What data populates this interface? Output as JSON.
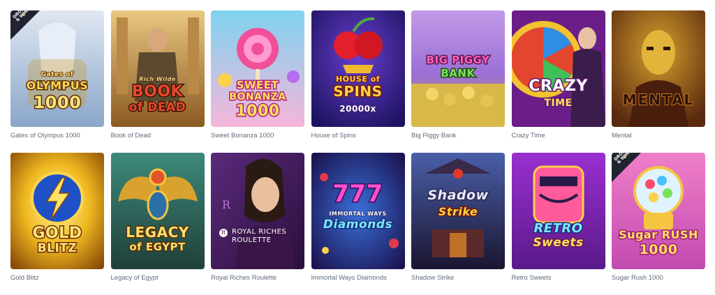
{
  "games": [
    {
      "caption": "Gates of Olympus 1000",
      "art": [
        "Gates of",
        "OLYMPUS",
        "1000"
      ],
      "badge": [
        "DROPS",
        "& WINS"
      ]
    },
    {
      "caption": "Book of Dead",
      "art": [
        "Rich Wilde",
        "BOOK",
        "of DEAD"
      ]
    },
    {
      "caption": "Sweet Bonanza 1000",
      "art": [
        "SWEET",
        "BONANZA",
        "1000"
      ]
    },
    {
      "caption": "House of Spins",
      "art": [
        "HOUSE of",
        "SPINS",
        "20000x"
      ]
    },
    {
      "caption": "Big Piggy Bank",
      "art": [
        "BIG PIGGY",
        "BANK"
      ]
    },
    {
      "caption": "Crazy Time",
      "art": [
        "CRAZY",
        "TIME"
      ]
    },
    {
      "caption": "Mental",
      "art": [
        "MENTAL"
      ]
    },
    {
      "caption": "Gold Blitz",
      "art": [
        "GOLD",
        "BLITZ"
      ]
    },
    {
      "caption": "Legacy of Egypt",
      "art": [
        "LEGACY",
        "of EGYPT"
      ]
    },
    {
      "caption": "Royal Riches Roulette",
      "art": [
        "ROYAL RICHES",
        "ROULETTE"
      ]
    },
    {
      "caption": "Immortal Ways Diamonds",
      "art": [
        "777",
        "IMMORTAL WAYS",
        "Diamonds"
      ]
    },
    {
      "caption": "Shadow Strike",
      "art": [
        "Shadow",
        "Strike"
      ]
    },
    {
      "caption": "Retro Sweets",
      "art": [
        "RETRO",
        "Sweets"
      ]
    },
    {
      "caption": "Sugar Rush 1000",
      "art": [
        "Sugar RUSH",
        "1000"
      ],
      "badge": [
        "DROPS",
        "& WINS"
      ]
    }
  ]
}
